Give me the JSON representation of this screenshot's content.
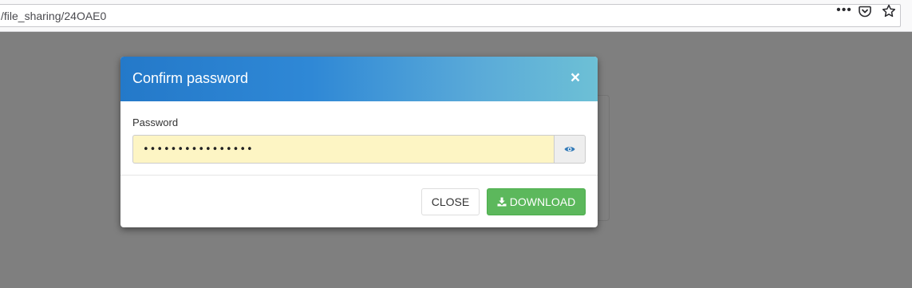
{
  "browser": {
    "url": "/file_sharing/24OAE0",
    "more_icon": "more-dots-icon",
    "pocket_icon": "pocket-icon",
    "bookmark_icon": "star-icon"
  },
  "modal": {
    "title": "Confirm password",
    "close_glyph": "×",
    "password_label": "Password",
    "password_value": "••••••••••••••••",
    "reveal_icon": "eye-icon",
    "close_button_label": "CLOSE",
    "download_button_label": "DOWNLOAD",
    "download_icon": "download-icon"
  },
  "colors": {
    "header_start": "#2479c9",
    "header_end": "#6dc0d6",
    "download_green": "#5cb85c",
    "input_autofill": "#fdf5c4",
    "overlay": "#808080",
    "eye_blue": "#337ab7"
  }
}
